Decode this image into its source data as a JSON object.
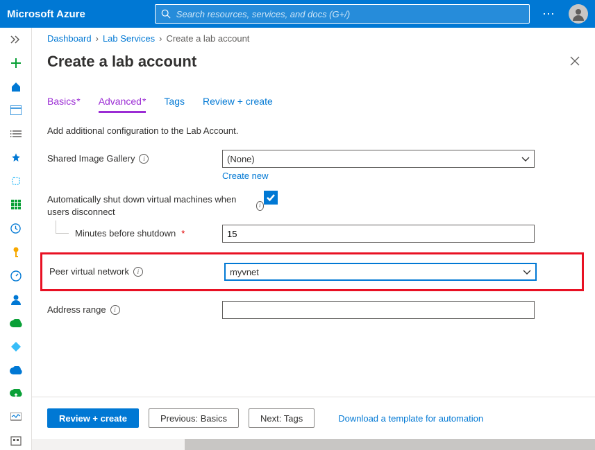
{
  "header": {
    "brand": "Microsoft Azure",
    "search_placeholder": "Search resources, services, and docs (G+/)"
  },
  "breadcrumbs": {
    "items": [
      "Dashboard",
      "Lab Services",
      "Create a lab account"
    ]
  },
  "page": {
    "title": "Create a lab account"
  },
  "tabs": {
    "basics": "Basics",
    "advanced": "Advanced",
    "tags": "Tags",
    "review": "Review + create"
  },
  "form": {
    "intro": "Add additional configuration to the Lab Account.",
    "shared_image_gallery_label": "Shared Image Gallery",
    "shared_image_gallery_value": "(None)",
    "create_new": "Create new",
    "auto_shutdown_label": "Automatically shut down virtual machines when users disconnect",
    "minutes_label": "Minutes before shutdown",
    "minutes_value": "15",
    "peer_vnet_label": "Peer virtual network",
    "peer_vnet_value": "myvnet",
    "address_range_label": "Address range",
    "address_range_value": ""
  },
  "footer": {
    "review": "Review + create",
    "previous": "Previous: Basics",
    "next": "Next: Tags",
    "download": "Download a template for automation"
  }
}
